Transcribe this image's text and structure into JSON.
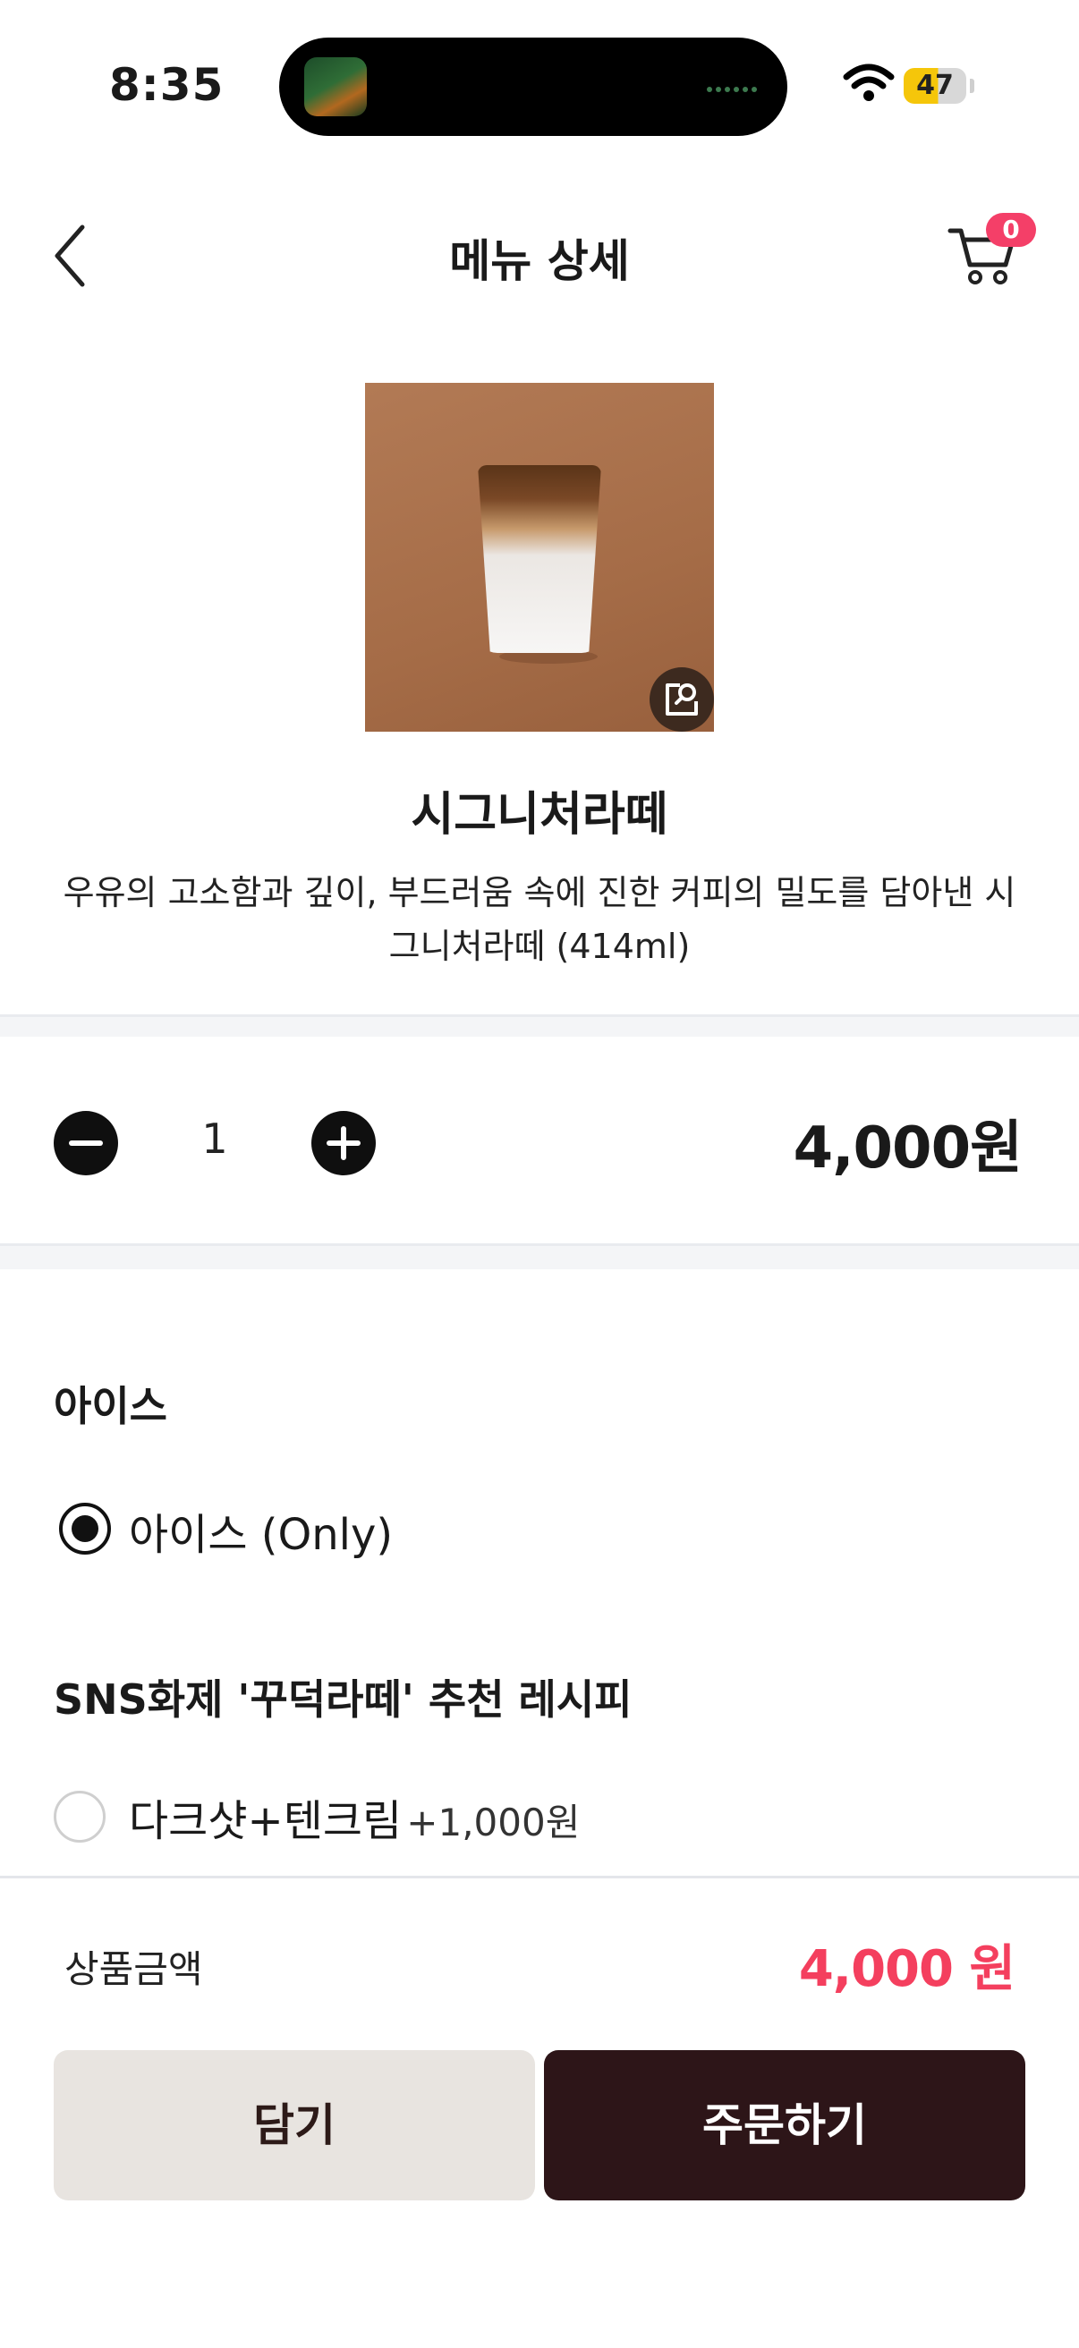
{
  "status_bar": {
    "time": "8:35",
    "battery": "47"
  },
  "header": {
    "title": "메뉴 상세",
    "cart_count": "0"
  },
  "product": {
    "name": "시그니처라떼",
    "description": "우유의 고소함과 깊이, 부드러움 속에 진한 커피의 밀도를 담아낸 시그니처라떼 (414ml)"
  },
  "quantity": {
    "value": "1",
    "price": "4,000원"
  },
  "options": [
    {
      "title": "아이스",
      "choices": [
        {
          "label": "아이스 (Only)",
          "extra": "",
          "selected": true
        }
      ]
    },
    {
      "title": "SNS화제 '꾸덕라떼' 추천 레시피",
      "choices": [
        {
          "label": "다크샷+텐크림",
          "extra": "+1,000원",
          "selected": false
        }
      ]
    }
  ],
  "footer": {
    "total_label": "상품금액",
    "total_price": "4,000 원",
    "add_cart_label": "담기",
    "order_label": "주문하기"
  },
  "colors": {
    "accent_pink": "#f43f5e",
    "primary_dark": "#2d1518",
    "secondary_btn": "#e8e4e0"
  },
  "icons": [
    "back-chevron-icon",
    "cart-icon",
    "zoom-icon",
    "minus-icon",
    "plus-icon",
    "wifi-icon",
    "battery-icon"
  ]
}
